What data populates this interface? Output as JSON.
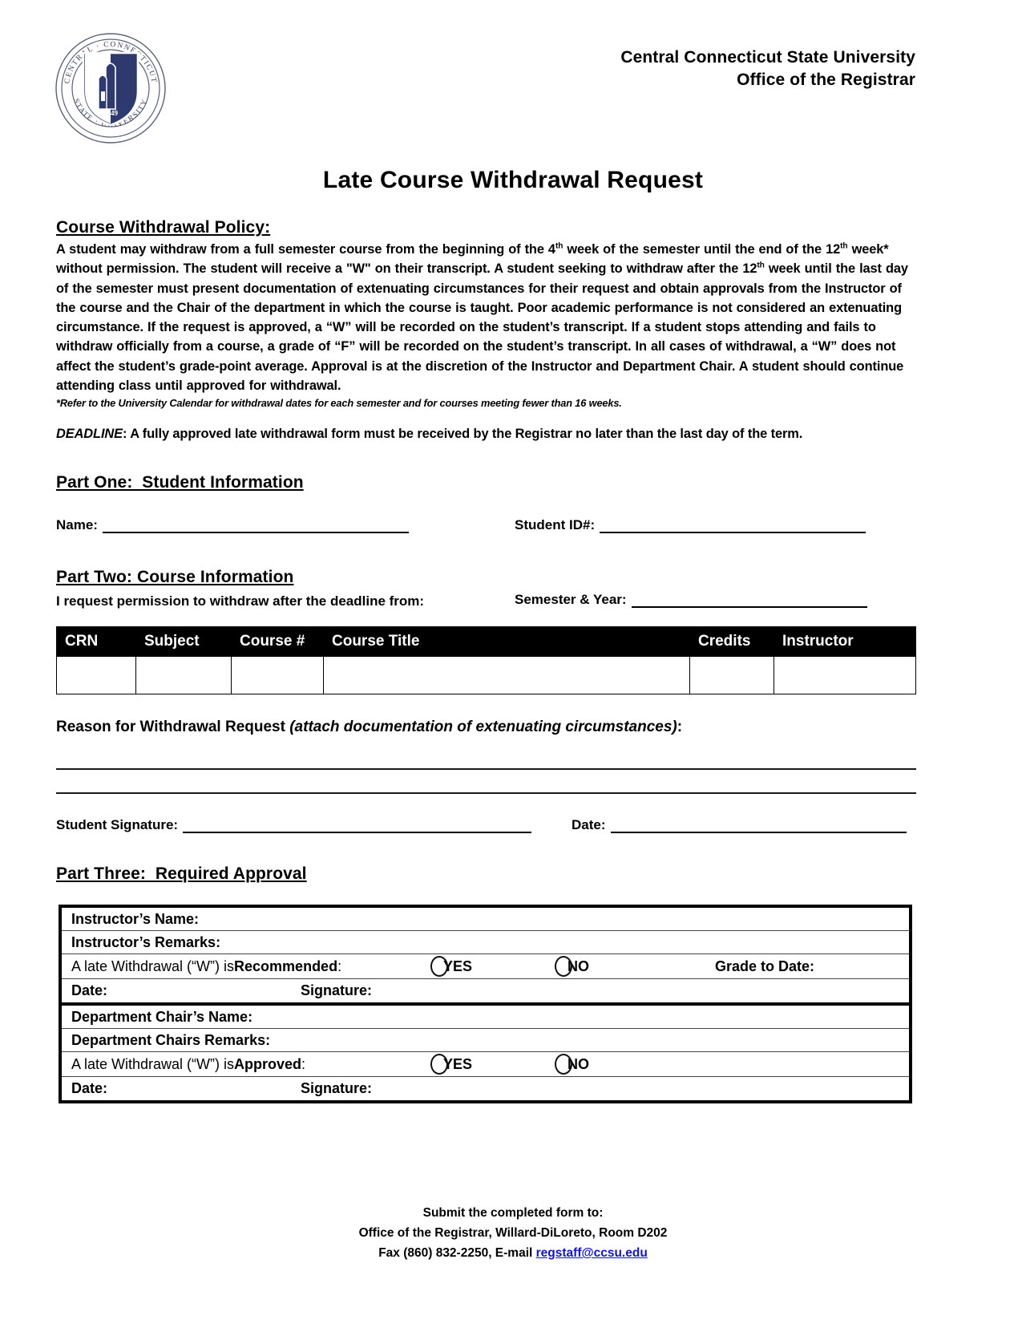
{
  "header": {
    "university": "Central Connecticut State University",
    "office": "Office of the Registrar",
    "seal": {
      "outer_top": "CENTRAL · CONNECTICUT",
      "outer_bottom": "STATE · UNIVERSITY",
      "year": "1849",
      "shield_color": "#2e3a6e"
    }
  },
  "title": "Late Course Withdrawal Request",
  "policy": {
    "heading": "Course Withdrawal Policy:",
    "body_part_1": "A student may withdraw from a full semester course from the beginning of the 4",
    "sup_1": "th",
    "body_part_2": " week of the semester until the end of the 12",
    "sup_2": "th",
    "body_part_3": " week* without permission. The student will receive a \"W\" on their transcript. A student seeking to withdraw after the 12",
    "sup_3": "th",
    "body_part_4": " week until the last day of the semester must present documentation of extenuating circumstances for their request and obtain approvals from the Instructor of the course and the Chair of the department in which the course is taught. Poor academic performance is not considered an extenuating circumstance. If the request is approved, a “W” will be recorded on the student’s transcript. If a student stops attending and fails to withdraw officially from a course, a grade of “F” will be recorded on the student’s transcript. In all cases of withdrawal, a “W” does not affect the student’s grade-point average. Approval is at the discretion of the Instructor and Department Chair. A student should continue attending class until approved for withdrawal.",
    "footnote": "*Refer to the University Calendar for withdrawal dates for each semester and for courses meeting fewer than 16 weeks.",
    "deadline_word": "DEADLINE",
    "deadline_text": ": A fully approved late withdrawal form must be received by the Registrar no later than the last day of the term."
  },
  "part_one": {
    "heading": "Part One:  Student Information",
    "name_label": "Name:",
    "name_value": "",
    "student_id_label": "Student ID#:",
    "student_id_value": ""
  },
  "part_two": {
    "heading": "Part Two: Course Information",
    "intro": "I request permission to withdraw after the deadline from:",
    "semester_label": "Semester & Year:",
    "semester_value": "",
    "table": {
      "columns": [
        "CRN",
        "Subject",
        "Course #",
        "Course Title",
        "Credits",
        "Instructor"
      ],
      "rows": [
        {
          "crn": "",
          "subject": "",
          "course_number": "",
          "course_title": "",
          "credits": "",
          "instructor": ""
        }
      ]
    },
    "reason_label": "Reason for Withdrawal Request ",
    "reason_label_italic": "(attach documentation of extenuating circumstances)",
    "reason_label_end": ":",
    "reason_value_line_1": "",
    "reason_value_line_2": "",
    "student_signature_label": "Student Signature:",
    "student_signature_value": "",
    "date_label": "Date:",
    "date_value": ""
  },
  "part_three": {
    "heading": "Part Three:  Required Approval",
    "instructor": {
      "name_label": "Instructor’s Name:",
      "name_value": "",
      "remarks_label": "Instructor’s Remarks:",
      "remarks_value": "",
      "recommend_prefix": "A late Withdrawal (“W”) is ",
      "recommend_word": "Recommended",
      "recommend_suffix": ":",
      "yes_label": "YES",
      "no_label": "NO",
      "grade_label": "Grade to Date:",
      "grade_value": "",
      "date_label": "Date:",
      "date_value": "",
      "signature_label": "Signature:",
      "signature_value": ""
    },
    "chair": {
      "name_label": "Department Chair’s Name:",
      "name_value": "",
      "remarks_label": "Department Chairs Remarks:",
      "remarks_value": "",
      "approve_prefix": "A late Withdrawal (“W”) is ",
      "approve_word": "Approved",
      "approve_suffix": ":",
      "yes_label": "YES",
      "no_label": "NO",
      "date_label": "Date:",
      "date_value": "",
      "signature_label": "Signature:",
      "signature_value": ""
    }
  },
  "footer": {
    "line1": "Submit the completed form to:",
    "line2": "Office of the Registrar, Willard-DiLoreto, Room D202",
    "line3_prefix": "Fax (860) 832-2250, E-mail ",
    "email": "regstaff@ccsu.edu",
    "link_color": "#1414c8"
  }
}
